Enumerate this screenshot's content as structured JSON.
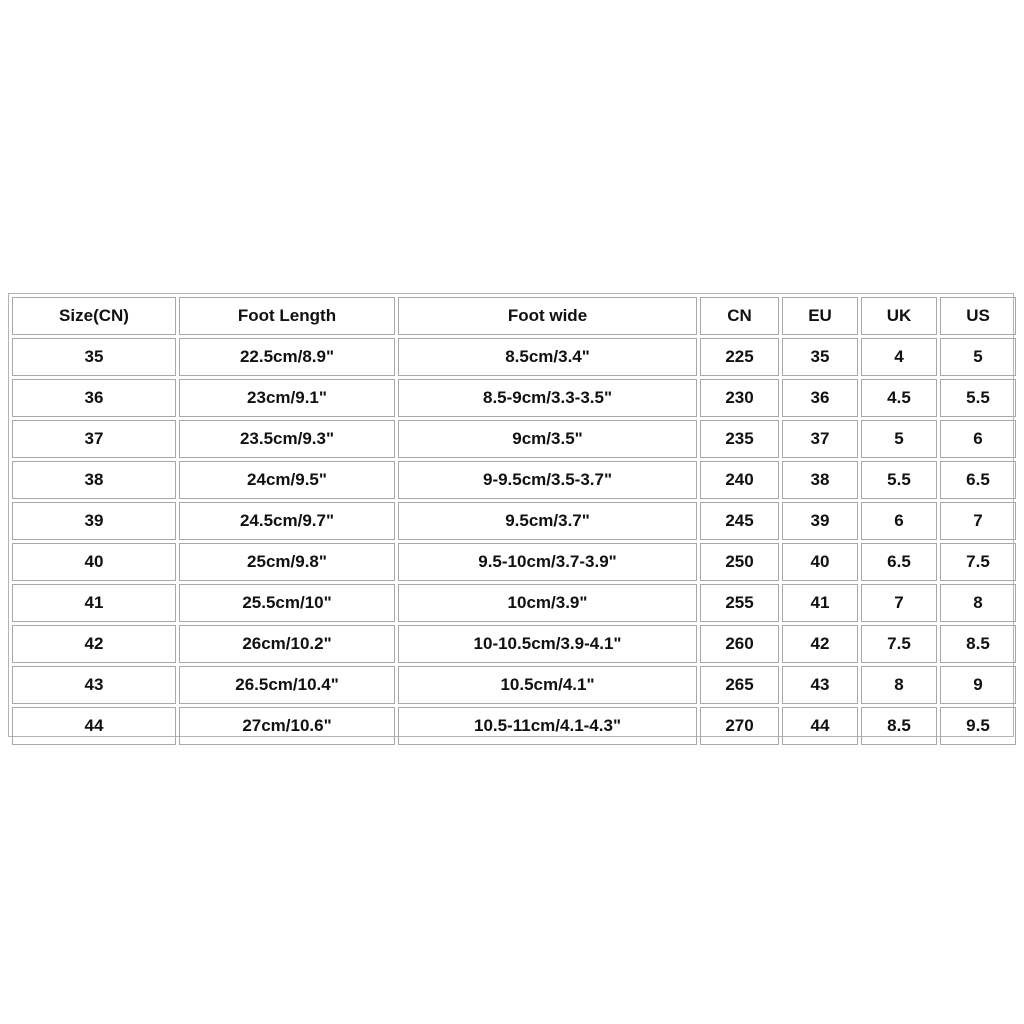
{
  "table": {
    "headers": [
      "Size(CN)",
      "Foot Length",
      "Foot wide",
      "CN",
      "EU",
      "UK",
      "US"
    ],
    "rows": [
      [
        "35",
        "22.5cm/8.9\"",
        "8.5cm/3.4\"",
        "225",
        "35",
        "4",
        "5"
      ],
      [
        "36",
        "23cm/9.1\"",
        "8.5-9cm/3.3-3.5\"",
        "230",
        "36",
        "4.5",
        "5.5"
      ],
      [
        "37",
        "23.5cm/9.3\"",
        "9cm/3.5\"",
        "235",
        "37",
        "5",
        "6"
      ],
      [
        "38",
        "24cm/9.5\"",
        "9-9.5cm/3.5-3.7\"",
        "240",
        "38",
        "5.5",
        "6.5"
      ],
      [
        "39",
        "24.5cm/9.7\"",
        "9.5cm/3.7\"",
        "245",
        "39",
        "6",
        "7"
      ],
      [
        "40",
        "25cm/9.8\"",
        "9.5-10cm/3.7-3.9\"",
        "250",
        "40",
        "6.5",
        "7.5"
      ],
      [
        "41",
        "25.5cm/10\"",
        "10cm/3.9\"",
        "255",
        "41",
        "7",
        "8"
      ],
      [
        "42",
        "26cm/10.2\"",
        "10-10.5cm/3.9-4.1\"",
        "260",
        "42",
        "7.5",
        "8.5"
      ],
      [
        "43",
        "26.5cm/10.4\"",
        "10.5cm/4.1\"",
        "265",
        "43",
        "8",
        "9"
      ],
      [
        "44",
        "27cm/10.6\"",
        "10.5-11cm/4.1-4.3\"",
        "270",
        "44",
        "8.5",
        "9.5"
      ]
    ]
  }
}
